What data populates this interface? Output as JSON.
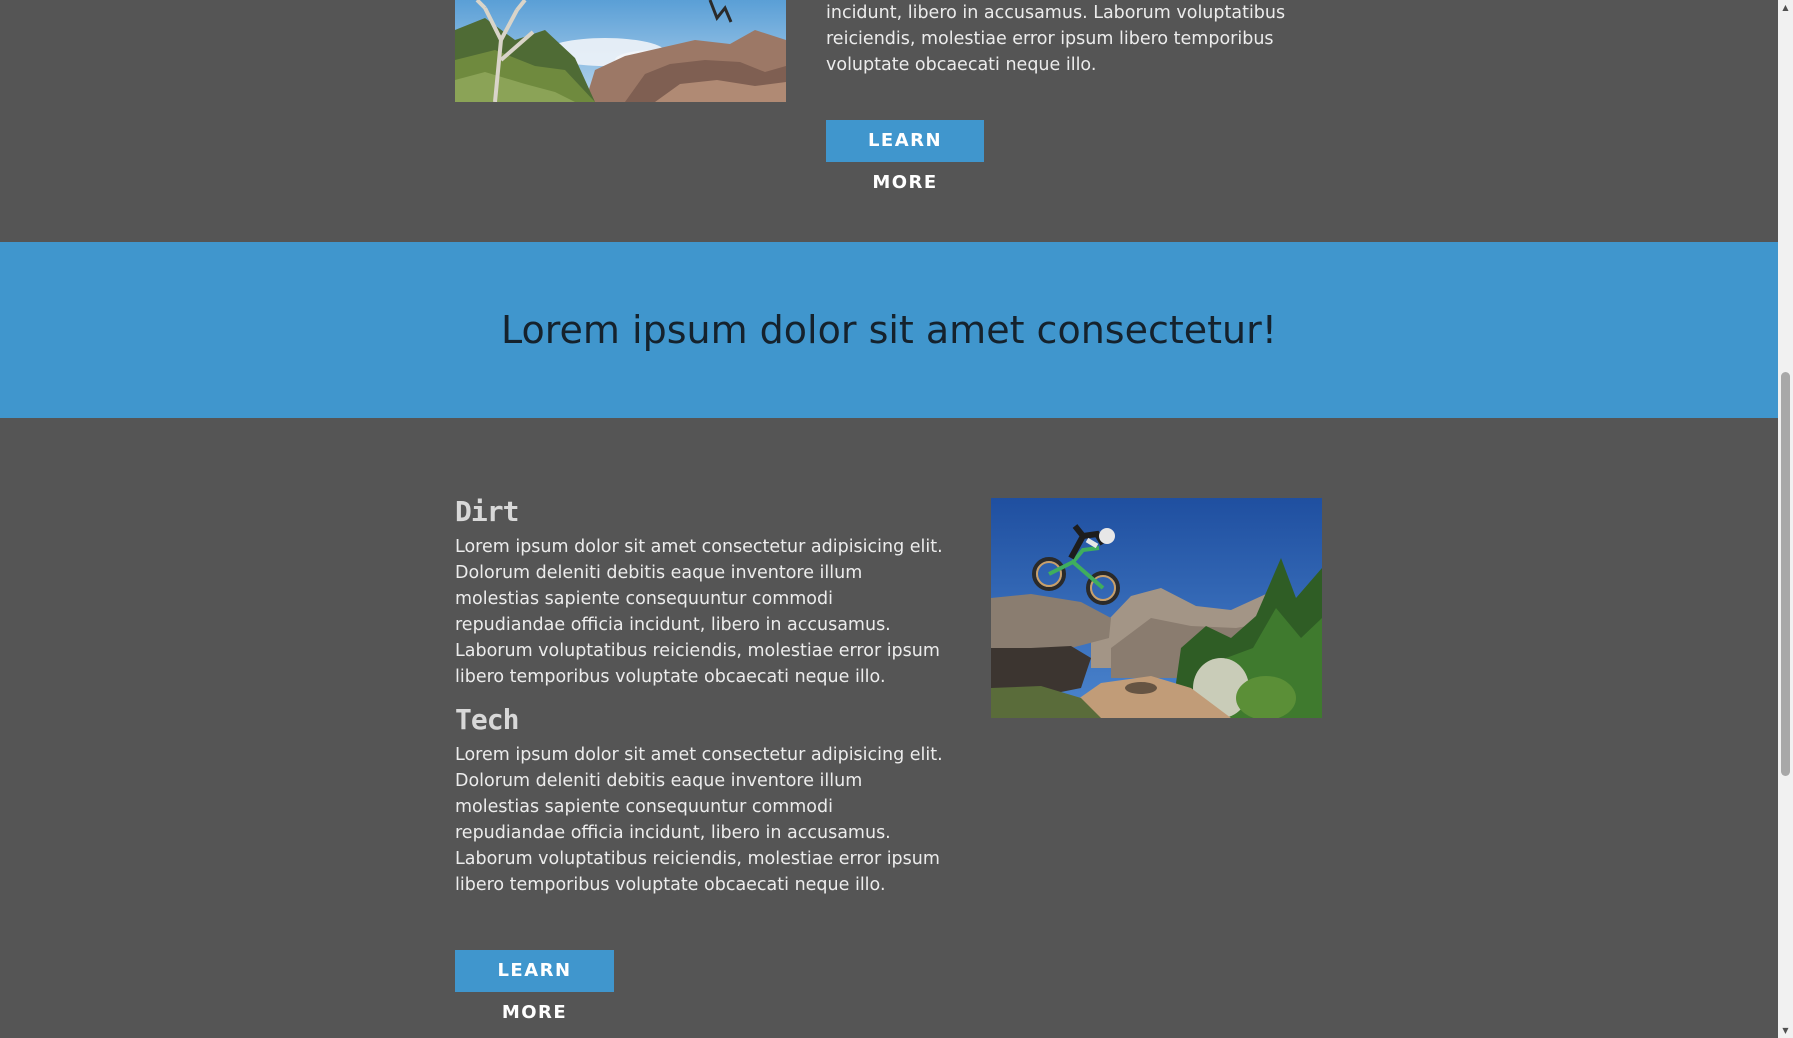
{
  "section_top": {
    "paragraph": "incidunt, libero in accusamus. Laborum voluptatibus reiciendis, molestiae error ipsum libero temporibus voluptate obcaecati neque illo.",
    "button_label": "LEARN MORE"
  },
  "banner": {
    "heading": "Lorem ipsum dolor sit amet consectetur!"
  },
  "section_2": {
    "dirt_heading": "Dirt",
    "dirt_text": "Lorem ipsum dolor sit amet consectetur adipisicing elit. Dolorum deleniti debitis eaque inventore illum molestias sapiente consequuntur commodi repudiandae officia incidunt, libero in accusamus. Laborum voluptatibus reiciendis, molestiae error ipsum libero temporibus voluptate obcaecati neque illo.",
    "tech_heading": "Tech",
    "tech_text": "Lorem ipsum dolor sit amet consectetur adipisicing elit. Dolorum deleniti debitis eaque inventore illum molestias sapiente consequuntur commodi repudiandae officia incidunt, libero in accusamus. Laborum voluptatibus reiciendis, molestiae error ipsum libero temporibus voluptate obcaecati neque illo.",
    "button_label": "LEARN MORE"
  },
  "colors": {
    "background": "#555555",
    "accent": "#4096cd",
    "banner_text": "#15222d",
    "body_text": "#ececec"
  },
  "scrollbar": {
    "up_icon": "chevron-up-icon",
    "down_icon": "chevron-down-icon"
  }
}
